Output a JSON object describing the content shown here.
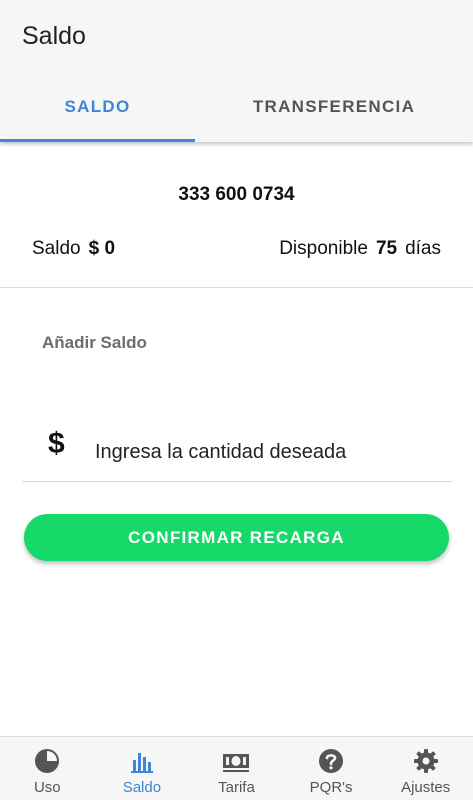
{
  "app": {
    "title": "Saldo"
  },
  "tabs": [
    {
      "label": "SALDO",
      "active": true
    },
    {
      "label": "TRANSFERENCIA",
      "active": false
    }
  ],
  "account": {
    "phone": "333 600 0734",
    "saldo_label": "Saldo",
    "saldo_value": "$ 0",
    "disponible_label": "Disponible",
    "disponible_value": "75",
    "disponible_unit": "días"
  },
  "recharge": {
    "section_label": "Añadir Saldo",
    "currency_symbol": "$",
    "amount_placeholder": "Ingresa la cantidad deseada",
    "amount_value": "",
    "confirm_label": "CONFIRMAR RECARGA",
    "confirm_color": "#17d96a"
  },
  "bottom_nav": [
    {
      "label": "Uso",
      "icon": "pie-chart-icon",
      "active": false
    },
    {
      "label": "Saldo",
      "icon": "bar-chart-icon",
      "active": true
    },
    {
      "label": "Tarifa",
      "icon": "money-icon",
      "active": false
    },
    {
      "label": "PQR's",
      "icon": "help-icon",
      "active": false
    },
    {
      "label": "Ajustes",
      "icon": "gear-icon",
      "active": false
    }
  ],
  "colors": {
    "accent": "#3d86d8",
    "inactive": "#555555"
  }
}
